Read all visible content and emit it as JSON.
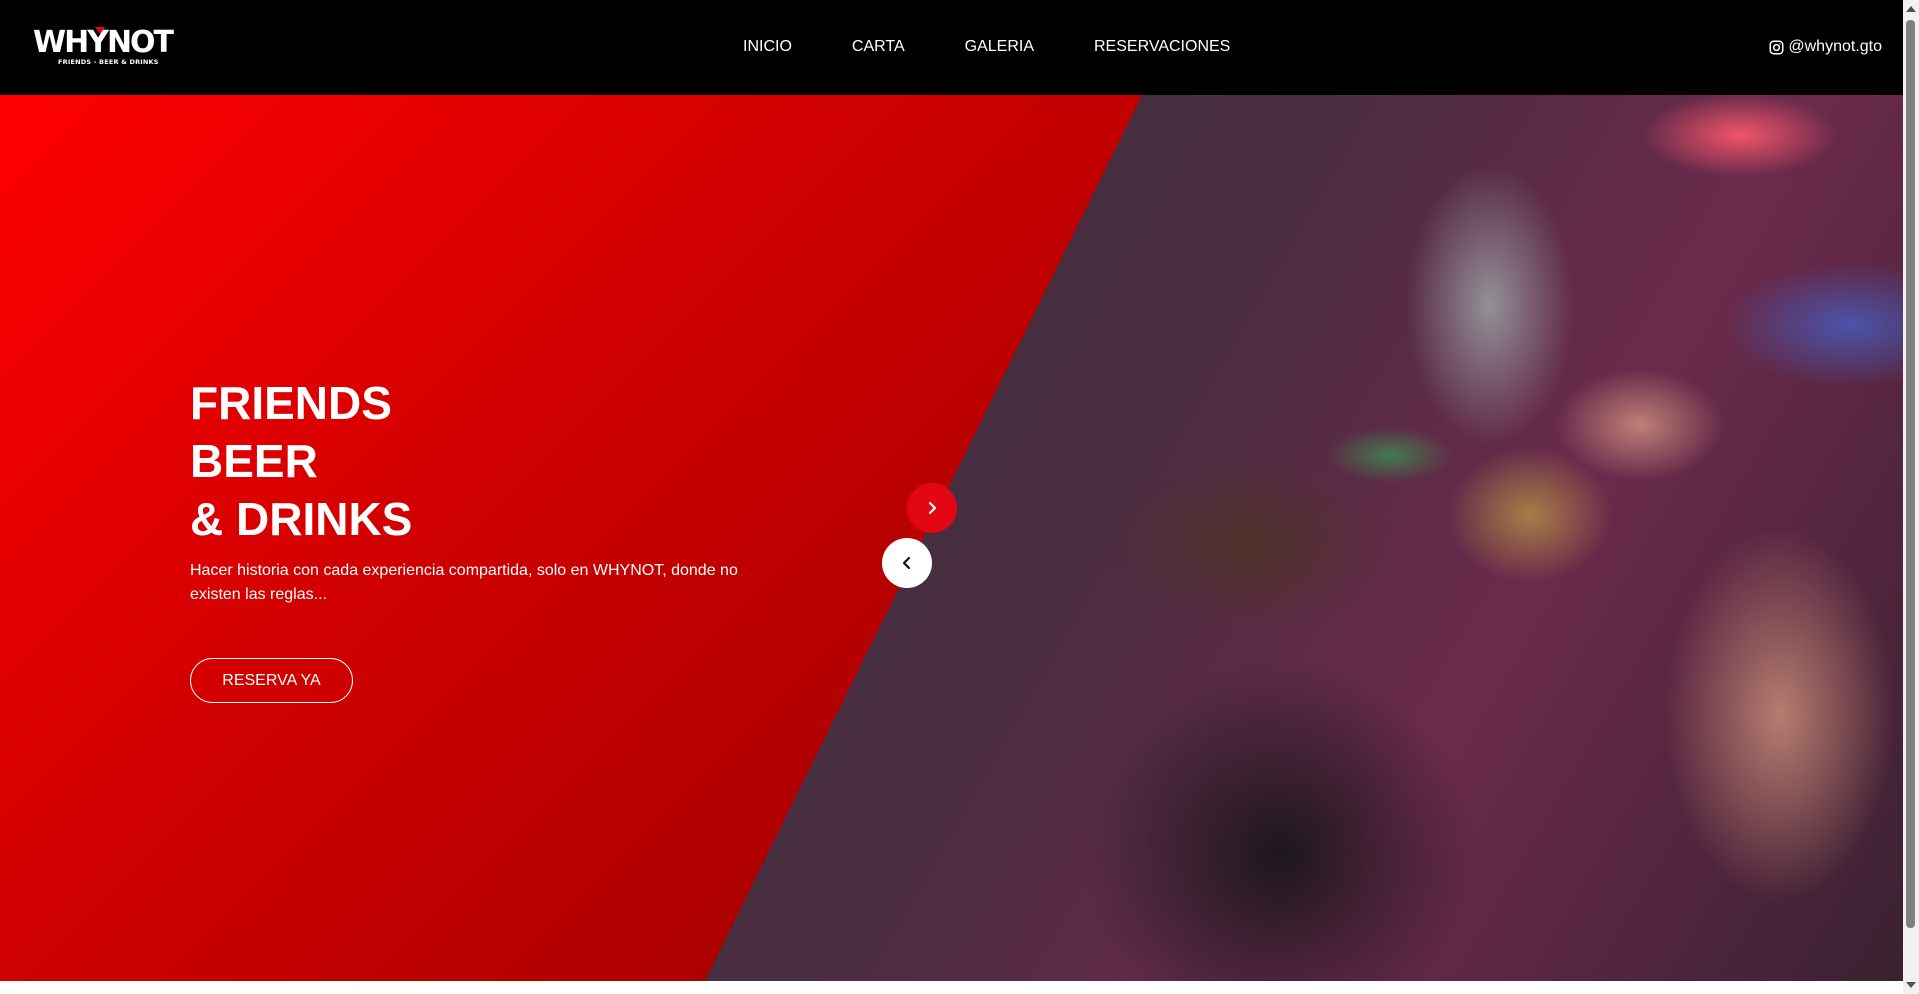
{
  "header": {
    "logo": {
      "text": "WHYNOT",
      "tagline": "FRIENDS - BEER & DRINKS"
    },
    "nav": [
      {
        "label": "INICIO"
      },
      {
        "label": "CARTA"
      },
      {
        "label": "GALERIA"
      },
      {
        "label": "RESERVACIONES"
      }
    ],
    "social": {
      "icon": "instagram-icon",
      "handle": "@whynot.gto"
    }
  },
  "hero": {
    "title_lines": [
      "FRIENDS",
      "BEER",
      "& DRINKS"
    ],
    "description": "Hacer historia con cada experiencia compartida, solo en WHYNOT, donde no existen las reglas...",
    "cta_label": "RESERVA YA",
    "next_icon": "chevron-right-icon",
    "prev_icon": "chevron-left-icon",
    "photo": "party-photo"
  },
  "colors": {
    "accent": "#e30613",
    "header_bg": "#000000",
    "panel_start": "#ff0000",
    "panel_end": "#7d0000"
  }
}
